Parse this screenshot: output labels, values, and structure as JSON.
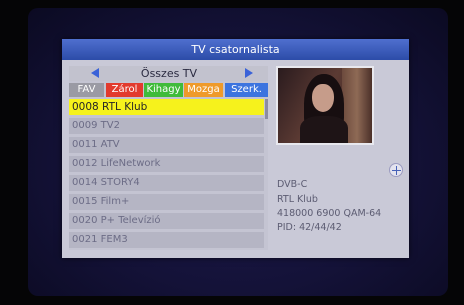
{
  "title": "TV csatornalista",
  "group": {
    "name": "Összes TV"
  },
  "buttons": {
    "fav": "FAV",
    "lock": "Zárol",
    "skip": "Kihagy",
    "move": "Mozga",
    "edit": "Szerk."
  },
  "channels": [
    "0008 RTL Klub",
    "0009 TV2",
    "0011 ATV",
    "0012 LifeNetwork",
    "0014 STORY4",
    "0015 Film+",
    "0020 P+ Televízió",
    "0021 FEM3"
  ],
  "selected_index": 0,
  "info": {
    "system": "DVB-C",
    "channel": "RTL Klub",
    "tuning": "418000  6900  QAM-64",
    "pid": "PID: 42/44/42"
  },
  "colors": {
    "selected": "#f6f21c",
    "title_bar": "#2c4ca8",
    "lock": "#e23a2e",
    "skip": "#3fbb3a",
    "move": "#ef9a2a",
    "edit": "#3c74df"
  },
  "icons": {
    "info": "plus-circle-icon",
    "left": "arrow-left-icon",
    "right": "arrow-right-icon"
  }
}
